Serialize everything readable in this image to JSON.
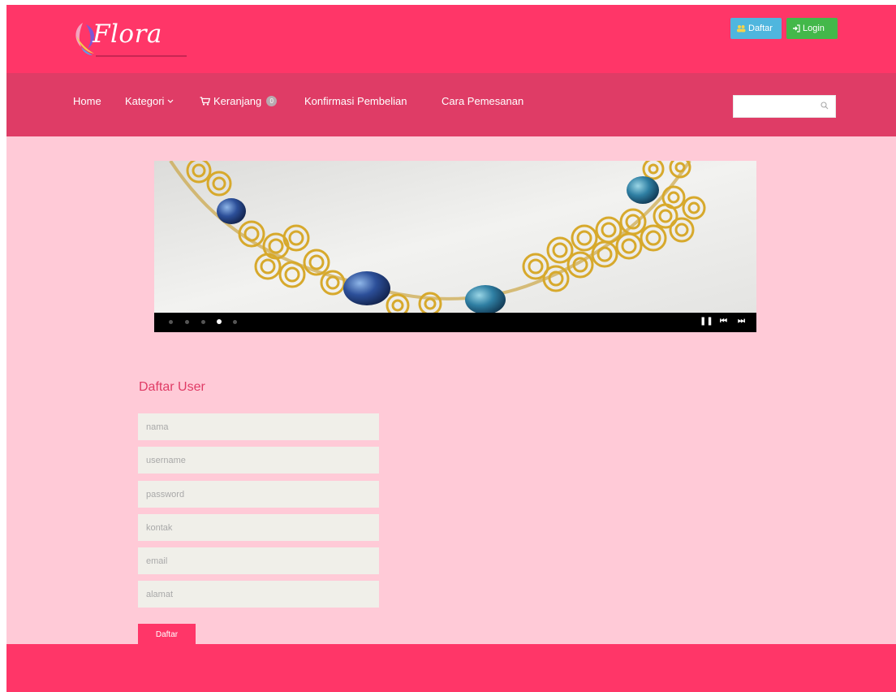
{
  "brand": {
    "name": "Flora"
  },
  "header": {
    "register_label": "Daftar",
    "login_label": "Login"
  },
  "nav": {
    "home": "Home",
    "category": "Kategori",
    "cart": "Keranjang",
    "cart_count": "0",
    "purchase_confirmation": "Konfirmasi Pembelian",
    "how_to_order": "Cara Pemesanan",
    "search_value": ""
  },
  "slider": {
    "slide_count": 5,
    "active_slide": 4
  },
  "form": {
    "title": "Daftar User",
    "fields": [
      {
        "name": "nama",
        "placeholder": "nama"
      },
      {
        "name": "username",
        "placeholder": "username"
      },
      {
        "name": "password",
        "placeholder": "password"
      },
      {
        "name": "kontak",
        "placeholder": "kontak"
      },
      {
        "name": "email",
        "placeholder": "email"
      },
      {
        "name": "alamat",
        "placeholder": "alamat"
      }
    ],
    "submit_label": "Daftar"
  },
  "colors": {
    "primary": "#ff3668",
    "nav": "#df3c66",
    "background": "#ffcad7",
    "register_button": "#4fb6de",
    "login_button": "#43b84a",
    "field": "#f0efe9"
  },
  "icons": {
    "register": "users-icon",
    "login": "sign-in-icon",
    "cart": "cart-icon",
    "category": "chevron-down-icon",
    "search": "search-icon"
  }
}
